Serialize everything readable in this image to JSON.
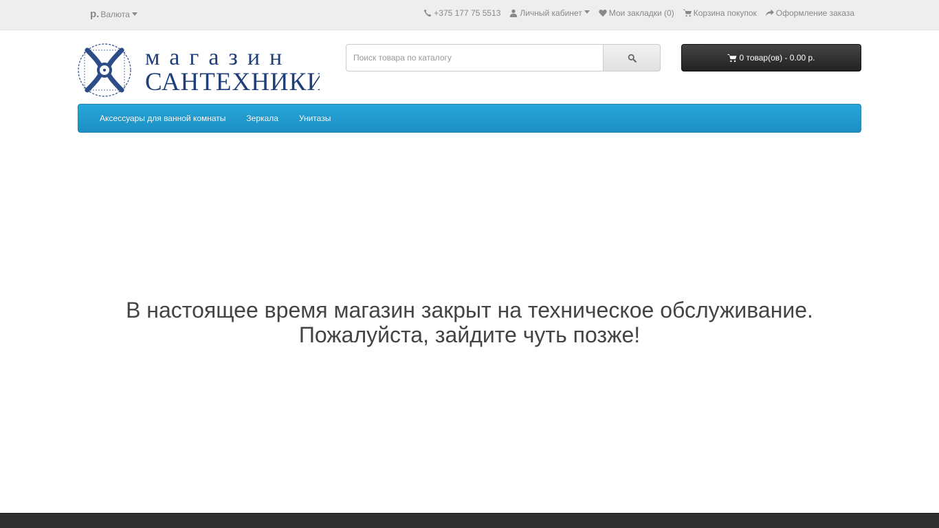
{
  "topbar": {
    "currency_symbol": "р.",
    "currency_label": "Валюта",
    "phone": "+375 177 75 5513",
    "account": "Личный кабинет",
    "wishlist": "Мои закладки (0)",
    "cart": "Корзина покупок",
    "checkout": "Оформление заказа"
  },
  "logo": {
    "line1": "магазин",
    "line2": "САНТЕХНИКИ"
  },
  "search": {
    "placeholder": "Поиск товара по каталогу"
  },
  "cart_button": {
    "label": "0 товар(ов) - 0.00 р."
  },
  "menu": {
    "items": [
      {
        "label": "Аксессуары для ванной комнаты"
      },
      {
        "label": "Зеркала"
      },
      {
        "label": "Унитазы"
      }
    ]
  },
  "message": {
    "line1": "В настоящее время магазин закрыт на техническое обслуживание.",
    "line2": "Пожалуйста, зайдите чуть позже!"
  },
  "colors": {
    "menu_bg": "#229bd0",
    "logo_blue": "#1f3f7a",
    "cart_bg": "#333333",
    "footer_bg": "#303030"
  }
}
